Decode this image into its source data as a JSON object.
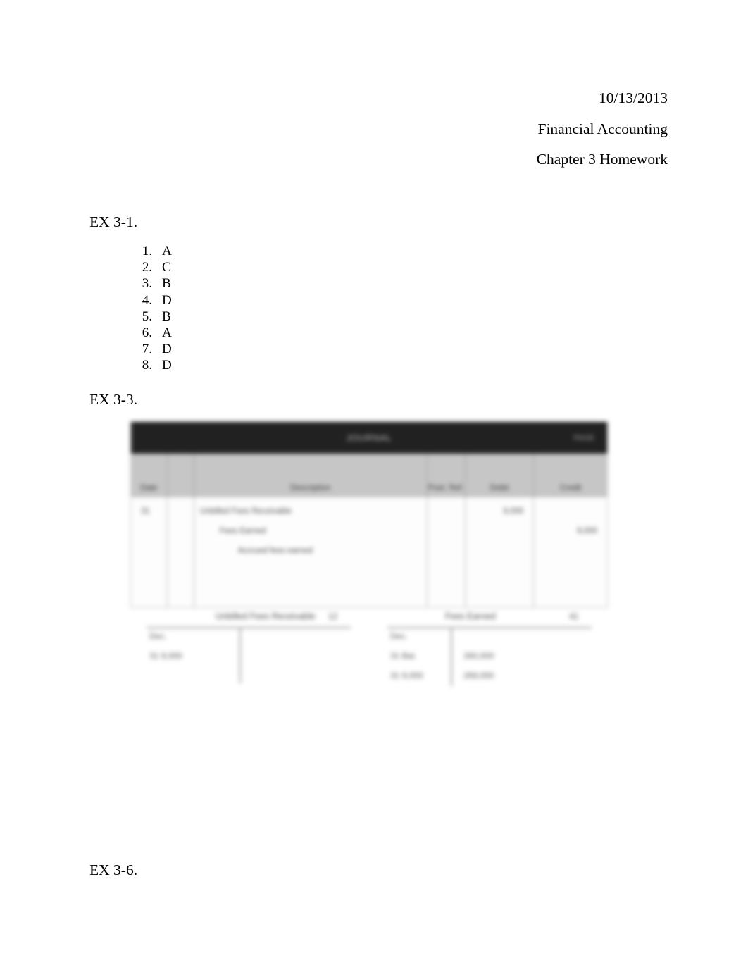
{
  "document": {
    "header": {
      "lines": [
        "10/13/2013",
        "Financial Accounting",
        "Chapter 3 Homework"
      ]
    },
    "sections": {
      "ex31": {
        "label": "EX 3-1.",
        "answers": [
          {
            "num": "1.",
            "value": "A"
          },
          {
            "num": "2.",
            "value": "C"
          },
          {
            "num": "3.",
            "value": "B"
          },
          {
            "num": "4.",
            "value": "D"
          },
          {
            "num": "5.",
            "value": "B"
          },
          {
            "num": "6.",
            "value": "A"
          },
          {
            "num": "7.",
            "value": "D"
          },
          {
            "num": "8.",
            "value": "D"
          }
        ]
      },
      "ex33": {
        "label": "EX 3-3.",
        "figure": {
          "type": "blurred-embedded-image",
          "journal": {
            "banner_title": "JOURNAL",
            "banner_page": "PAGE",
            "columns": [
              "Date",
              "",
              "Description",
              "Post. Ref.",
              "Debit",
              "Credit"
            ],
            "rows": [
              {
                "date": "31",
                "description": "Unbilled Fees Receivable",
                "ref": "",
                "debit": "9,000",
                "credit": ""
              },
              {
                "date": "",
                "description": "Fees Earned",
                "ref": "",
                "debit": "",
                "credit": "9,000"
              },
              {
                "date": "",
                "description": "Accrued fees earned",
                "ref": "",
                "debit": "",
                "credit": ""
              }
            ]
          },
          "t_accounts": [
            {
              "title": "Unbilled Fees Receivable",
              "acct_no": "12",
              "left_entries": [
                "Dec.",
                "31  9,000"
              ],
              "right_entries": []
            },
            {
              "title": "Fees Earned",
              "acct_no": "41",
              "left_entries": [
                "Dec.",
                "31  Bal.",
                "31  9,000"
              ],
              "right_entries": [
                "260,000",
                "269,000"
              ]
            }
          ]
        }
      },
      "ex36": {
        "label": "EX 3-6."
      }
    }
  }
}
